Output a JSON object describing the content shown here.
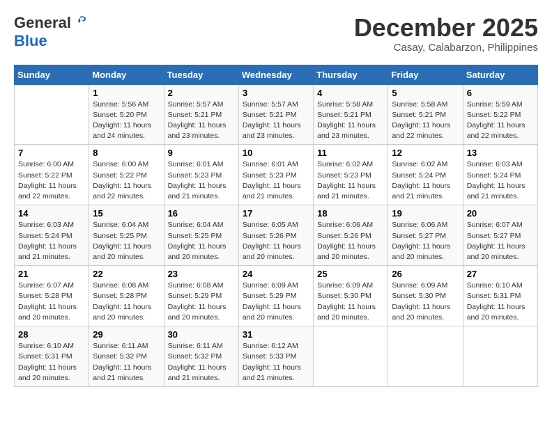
{
  "header": {
    "logo_general": "General",
    "logo_blue": "Blue",
    "month_title": "December 2025",
    "location": "Casay, Calabarzon, Philippines"
  },
  "weekdays": [
    "Sunday",
    "Monday",
    "Tuesday",
    "Wednesday",
    "Thursday",
    "Friday",
    "Saturday"
  ],
  "weeks": [
    [
      {
        "day": "",
        "sunrise": "",
        "sunset": "",
        "daylight": ""
      },
      {
        "day": "1",
        "sunrise": "Sunrise: 5:56 AM",
        "sunset": "Sunset: 5:20 PM",
        "daylight": "Daylight: 11 hours and 24 minutes."
      },
      {
        "day": "2",
        "sunrise": "Sunrise: 5:57 AM",
        "sunset": "Sunset: 5:21 PM",
        "daylight": "Daylight: 11 hours and 23 minutes."
      },
      {
        "day": "3",
        "sunrise": "Sunrise: 5:57 AM",
        "sunset": "Sunset: 5:21 PM",
        "daylight": "Daylight: 11 hours and 23 minutes."
      },
      {
        "day": "4",
        "sunrise": "Sunrise: 5:58 AM",
        "sunset": "Sunset: 5:21 PM",
        "daylight": "Daylight: 11 hours and 23 minutes."
      },
      {
        "day": "5",
        "sunrise": "Sunrise: 5:58 AM",
        "sunset": "Sunset: 5:21 PM",
        "daylight": "Daylight: 11 hours and 22 minutes."
      },
      {
        "day": "6",
        "sunrise": "Sunrise: 5:59 AM",
        "sunset": "Sunset: 5:22 PM",
        "daylight": "Daylight: 11 hours and 22 minutes."
      }
    ],
    [
      {
        "day": "7",
        "sunrise": "Sunrise: 6:00 AM",
        "sunset": "Sunset: 5:22 PM",
        "daylight": "Daylight: 11 hours and 22 minutes."
      },
      {
        "day": "8",
        "sunrise": "Sunrise: 6:00 AM",
        "sunset": "Sunset: 5:22 PM",
        "daylight": "Daylight: 11 hours and 22 minutes."
      },
      {
        "day": "9",
        "sunrise": "Sunrise: 6:01 AM",
        "sunset": "Sunset: 5:23 PM",
        "daylight": "Daylight: 11 hours and 21 minutes."
      },
      {
        "day": "10",
        "sunrise": "Sunrise: 6:01 AM",
        "sunset": "Sunset: 5:23 PM",
        "daylight": "Daylight: 11 hours and 21 minutes."
      },
      {
        "day": "11",
        "sunrise": "Sunrise: 6:02 AM",
        "sunset": "Sunset: 5:23 PM",
        "daylight": "Daylight: 11 hours and 21 minutes."
      },
      {
        "day": "12",
        "sunrise": "Sunrise: 6:02 AM",
        "sunset": "Sunset: 5:24 PM",
        "daylight": "Daylight: 11 hours and 21 minutes."
      },
      {
        "day": "13",
        "sunrise": "Sunrise: 6:03 AM",
        "sunset": "Sunset: 5:24 PM",
        "daylight": "Daylight: 11 hours and 21 minutes."
      }
    ],
    [
      {
        "day": "14",
        "sunrise": "Sunrise: 6:03 AM",
        "sunset": "Sunset: 5:24 PM",
        "daylight": "Daylight: 11 hours and 21 minutes."
      },
      {
        "day": "15",
        "sunrise": "Sunrise: 6:04 AM",
        "sunset": "Sunset: 5:25 PM",
        "daylight": "Daylight: 11 hours and 20 minutes."
      },
      {
        "day": "16",
        "sunrise": "Sunrise: 6:04 AM",
        "sunset": "Sunset: 5:25 PM",
        "daylight": "Daylight: 11 hours and 20 minutes."
      },
      {
        "day": "17",
        "sunrise": "Sunrise: 6:05 AM",
        "sunset": "Sunset: 5:26 PM",
        "daylight": "Daylight: 11 hours and 20 minutes."
      },
      {
        "day": "18",
        "sunrise": "Sunrise: 6:06 AM",
        "sunset": "Sunset: 5:26 PM",
        "daylight": "Daylight: 11 hours and 20 minutes."
      },
      {
        "day": "19",
        "sunrise": "Sunrise: 6:06 AM",
        "sunset": "Sunset: 5:27 PM",
        "daylight": "Daylight: 11 hours and 20 minutes."
      },
      {
        "day": "20",
        "sunrise": "Sunrise: 6:07 AM",
        "sunset": "Sunset: 5:27 PM",
        "daylight": "Daylight: 11 hours and 20 minutes."
      }
    ],
    [
      {
        "day": "21",
        "sunrise": "Sunrise: 6:07 AM",
        "sunset": "Sunset: 5:28 PM",
        "daylight": "Daylight: 11 hours and 20 minutes."
      },
      {
        "day": "22",
        "sunrise": "Sunrise: 6:08 AM",
        "sunset": "Sunset: 5:28 PM",
        "daylight": "Daylight: 11 hours and 20 minutes."
      },
      {
        "day": "23",
        "sunrise": "Sunrise: 6:08 AM",
        "sunset": "Sunset: 5:29 PM",
        "daylight": "Daylight: 11 hours and 20 minutes."
      },
      {
        "day": "24",
        "sunrise": "Sunrise: 6:09 AM",
        "sunset": "Sunset: 5:29 PM",
        "daylight": "Daylight: 11 hours and 20 minutes."
      },
      {
        "day": "25",
        "sunrise": "Sunrise: 6:09 AM",
        "sunset": "Sunset: 5:30 PM",
        "daylight": "Daylight: 11 hours and 20 minutes."
      },
      {
        "day": "26",
        "sunrise": "Sunrise: 6:09 AM",
        "sunset": "Sunset: 5:30 PM",
        "daylight": "Daylight: 11 hours and 20 minutes."
      },
      {
        "day": "27",
        "sunrise": "Sunrise: 6:10 AM",
        "sunset": "Sunset: 5:31 PM",
        "daylight": "Daylight: 11 hours and 20 minutes."
      }
    ],
    [
      {
        "day": "28",
        "sunrise": "Sunrise: 6:10 AM",
        "sunset": "Sunset: 5:31 PM",
        "daylight": "Daylight: 11 hours and 20 minutes."
      },
      {
        "day": "29",
        "sunrise": "Sunrise: 6:11 AM",
        "sunset": "Sunset: 5:32 PM",
        "daylight": "Daylight: 11 hours and 21 minutes."
      },
      {
        "day": "30",
        "sunrise": "Sunrise: 6:11 AM",
        "sunset": "Sunset: 5:32 PM",
        "daylight": "Daylight: 11 hours and 21 minutes."
      },
      {
        "day": "31",
        "sunrise": "Sunrise: 6:12 AM",
        "sunset": "Sunset: 5:33 PM",
        "daylight": "Daylight: 11 hours and 21 minutes."
      },
      {
        "day": "",
        "sunrise": "",
        "sunset": "",
        "daylight": ""
      },
      {
        "day": "",
        "sunrise": "",
        "sunset": "",
        "daylight": ""
      },
      {
        "day": "",
        "sunrise": "",
        "sunset": "",
        "daylight": ""
      }
    ]
  ]
}
